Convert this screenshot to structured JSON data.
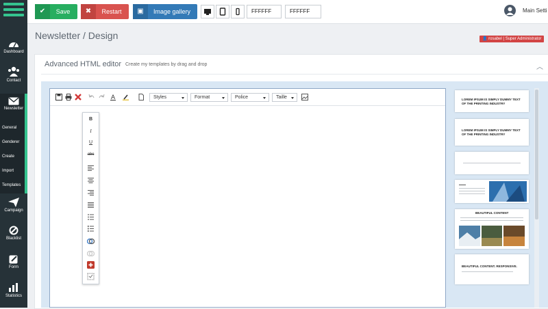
{
  "sidebar": {
    "items": [
      {
        "label": "Dashboard"
      },
      {
        "label": "Contact"
      },
      {
        "label": "Newsletter"
      },
      {
        "label": "Campaign"
      },
      {
        "label": "Blacklist"
      },
      {
        "label": "Form"
      },
      {
        "label": "Statistics"
      }
    ],
    "sub_items": [
      {
        "label": "General"
      },
      {
        "label": "Genderer"
      },
      {
        "label": "Create"
      },
      {
        "label": "Import"
      },
      {
        "label": "Templates"
      }
    ]
  },
  "toolbar": {
    "save_label": "Save",
    "restart_label": "Restart",
    "gallery_label": "Image gallery",
    "color1": "FFFFFF",
    "color2": "FFFFFF",
    "colors": {
      "save": "#27ae60",
      "restart": "#d9534f",
      "gallery": "#337ab7"
    }
  },
  "user": {
    "name": "Main Setti"
  },
  "header": {
    "title": "Newsletter / Design",
    "role_badge": "rosabel | Super Administrator"
  },
  "panel": {
    "title": "Advanced HTML editor",
    "subtitle": "Create my templates by drag and drop"
  },
  "editor": {
    "selects": [
      {
        "label": "Styles"
      },
      {
        "label": "Format"
      },
      {
        "label": "Police"
      },
      {
        "label": "Taille"
      }
    ],
    "format_buttons": [
      {
        "label": "B"
      },
      {
        "label": "I"
      },
      {
        "label": "U"
      },
      {
        "label": "abc"
      }
    ]
  },
  "templates": [
    {
      "title": "LOREM IPSUM IS SIMPLY DUMMY TEXT OF THE PRINTING INDUSTRY"
    },
    {
      "title": "LOREM IPSUM IS SIMPLY DUMMY TEXT OF THE PRINTING INDUSTRY"
    },
    {
      "title": "BEAUTIFUL CONTENT"
    },
    {
      "title": "BEAUTIFUL CONTENT. RESPONSIVE."
    }
  ]
}
